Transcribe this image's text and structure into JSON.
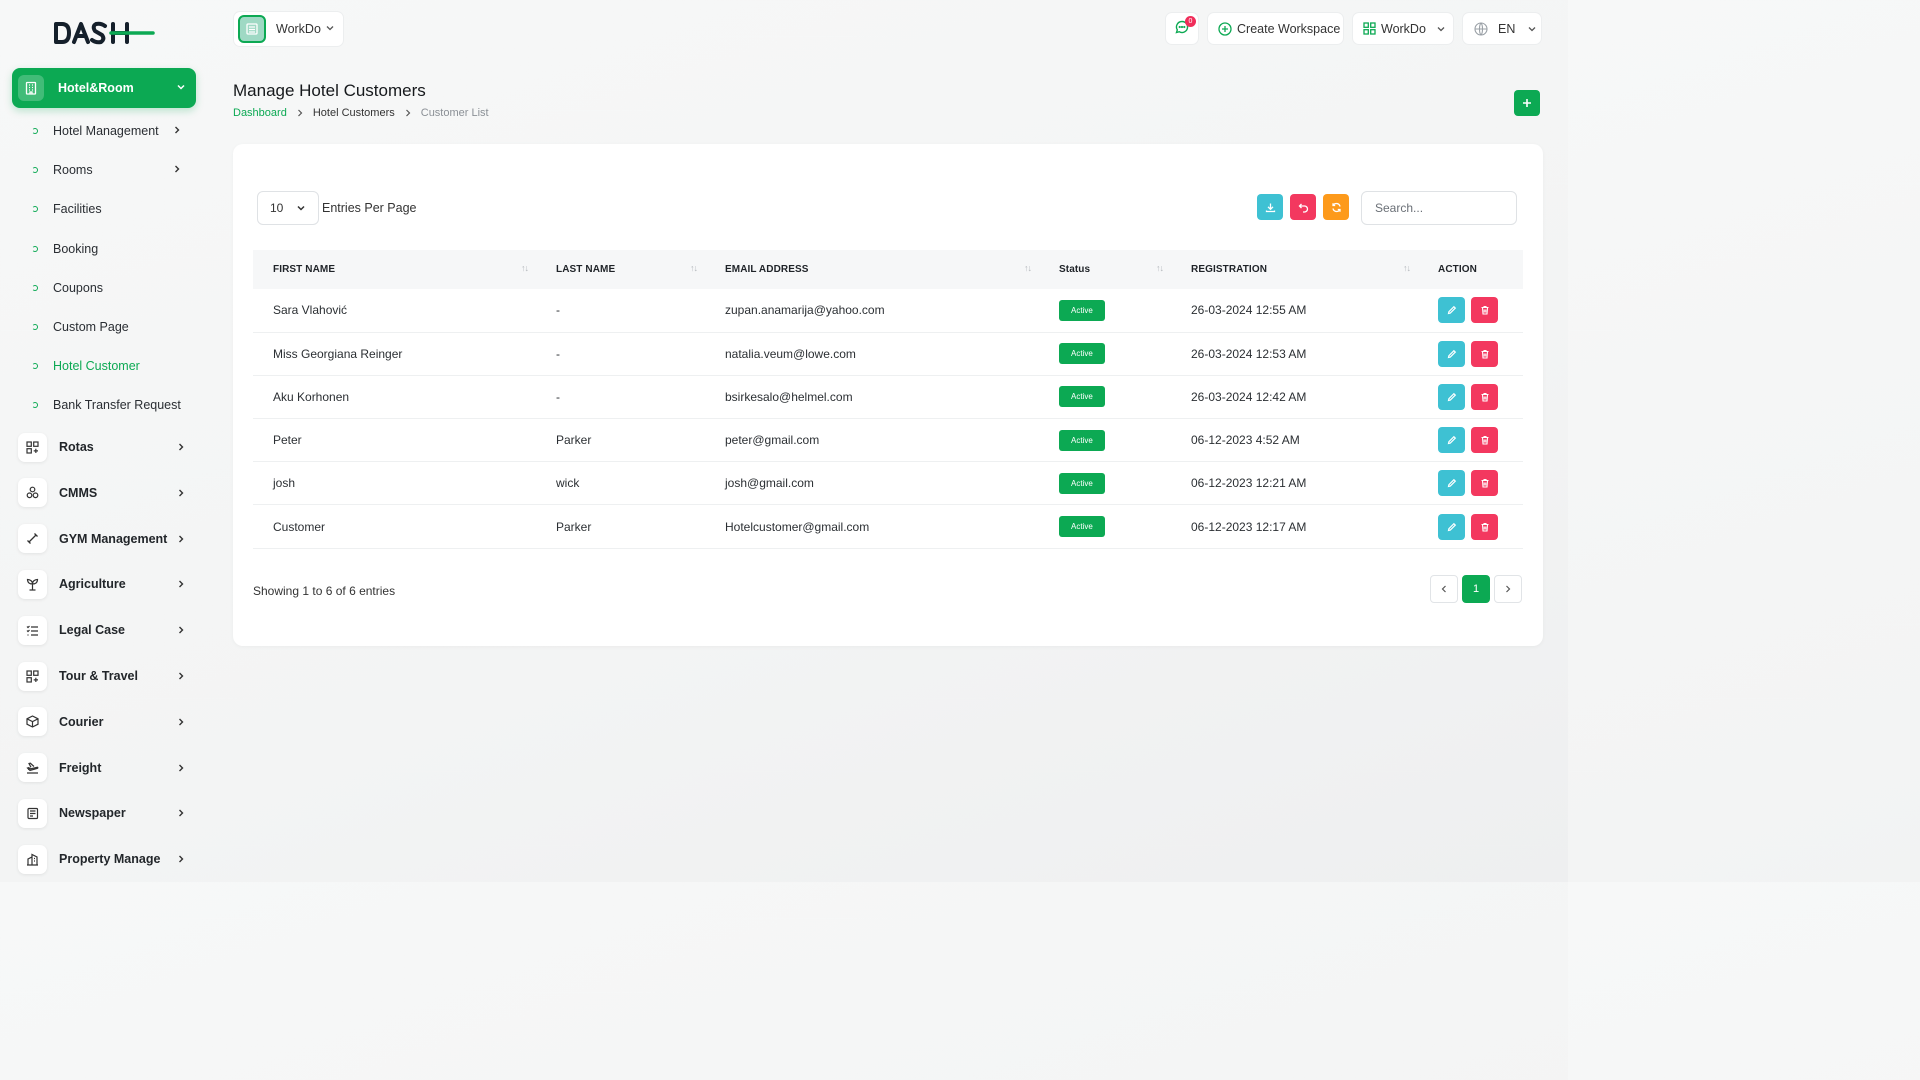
{
  "sidebar": {
    "active_module": "Hotel&Room",
    "sub_items": [
      {
        "label": "Hotel Management",
        "has_children": true
      },
      {
        "label": "Rooms",
        "has_children": true
      },
      {
        "label": "Facilities",
        "has_children": false
      },
      {
        "label": "Booking",
        "has_children": false
      },
      {
        "label": "Coupons",
        "has_children": false
      },
      {
        "label": "Custom Page",
        "has_children": false
      },
      {
        "label": "Hotel Customer",
        "has_children": false,
        "active": true
      },
      {
        "label": "Bank Transfer Request",
        "has_children": false
      }
    ],
    "modules": [
      {
        "label": "Rotas",
        "icon": "grid-plus-icon"
      },
      {
        "label": "CMMS",
        "icon": "circles-icon"
      },
      {
        "label": "GYM Management",
        "icon": "dumbbell-icon"
      },
      {
        "label": "Agriculture",
        "icon": "plant-icon"
      },
      {
        "label": "Legal Case",
        "icon": "list-check-icon"
      },
      {
        "label": "Tour & Travel",
        "icon": "grid-plus-icon"
      },
      {
        "label": "Courier",
        "icon": "box-icon"
      },
      {
        "label": "Freight",
        "icon": "plane-icon"
      },
      {
        "label": "Newspaper",
        "icon": "newspaper-icon"
      },
      {
        "label": "Property Manage",
        "icon": "building-icon"
      }
    ]
  },
  "topbar": {
    "workspace": "WorkDo",
    "notification_count": "0",
    "create_workspace": "Create Workspace",
    "workspace_menu": "WorkDo",
    "language": "EN"
  },
  "page": {
    "title": "Manage Hotel Customers",
    "breadcrumb": [
      "Dashboard",
      "Hotel Customers",
      "Customer List"
    ]
  },
  "table_controls": {
    "per_page": "10",
    "per_page_label": "Entries Per Page",
    "search_placeholder": "Search..."
  },
  "table": {
    "columns": [
      "FIRST NAME",
      "LAST NAME",
      "EMAIL ADDRESS",
      "Status",
      "REGISTRATION",
      "ACTION"
    ],
    "rows": [
      {
        "first": "Sara Vlahović",
        "last": "-",
        "email": "zupan.anamarija@yahoo.com",
        "status": "Active",
        "reg": "26-03-2024 12:55 AM"
      },
      {
        "first": "Miss Georgiana Reinger",
        "last": "-",
        "email": "natalia.veum@lowe.com",
        "status": "Active",
        "reg": "26-03-2024 12:53 AM"
      },
      {
        "first": "Aku Korhonen",
        "last": "-",
        "email": "bsirkesalo@helmel.com",
        "status": "Active",
        "reg": "26-03-2024 12:42 AM"
      },
      {
        "first": "Peter",
        "last": "Parker",
        "email": "peter@gmail.com",
        "status": "Active",
        "reg": "06-12-2023 4:52 AM"
      },
      {
        "first": "josh",
        "last": "wick",
        "email": "josh@gmail.com",
        "status": "Active",
        "reg": "06-12-2023 12:21 AM"
      },
      {
        "first": "Customer",
        "last": "Parker",
        "email": "Hotelcustomer@gmail.com",
        "status": "Active",
        "reg": "06-12-2023 12:17 AM"
      }
    ]
  },
  "footer": {
    "showing": "Showing 1 to 6 of 6 entries",
    "current_page": "1"
  },
  "colors": {
    "accent": "#0ca953",
    "edit": "#3ec1d3",
    "delete": "#f3385f",
    "refresh": "#fd9a1b"
  }
}
